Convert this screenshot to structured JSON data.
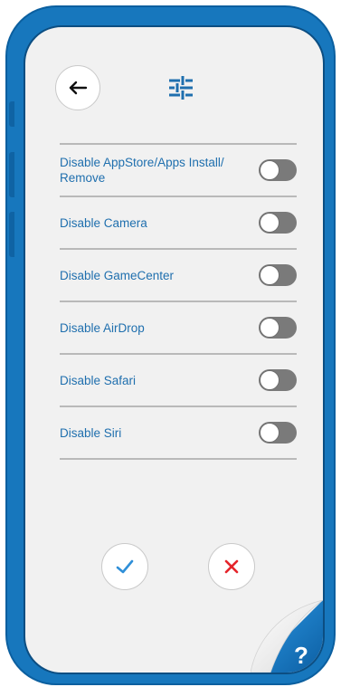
{
  "header": {
    "back_icon": "arrow-left-icon",
    "filter_icon": "sliders-icon"
  },
  "settings": [
    {
      "label": "Disable AppStore/Apps Install/ Remove",
      "enabled": false
    },
    {
      "label": "Disable Camera",
      "enabled": false
    },
    {
      "label": "Disable GameCenter",
      "enabled": false
    },
    {
      "label": "Disable AirDrop",
      "enabled": false
    },
    {
      "label": "Disable Safari",
      "enabled": false
    },
    {
      "label": "Disable Siri",
      "enabled": false
    }
  ],
  "actions": {
    "confirm_icon": "checkmark-icon",
    "cancel_icon": "close-icon"
  },
  "help": {
    "label": "?"
  },
  "colors": {
    "frame": "#1777bd",
    "accent": "#1f6fae",
    "screen": "#f1f1f1",
    "toggle_off": "#7a7a7a",
    "confirm": "#2f8fd8",
    "cancel": "#e5242b"
  }
}
